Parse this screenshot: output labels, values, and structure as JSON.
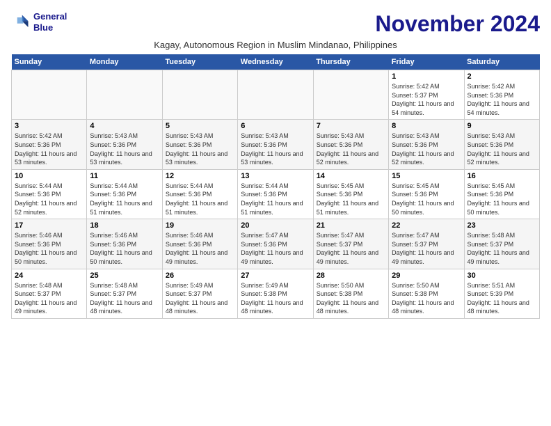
{
  "header": {
    "logo_line1": "General",
    "logo_line2": "Blue",
    "month": "November 2024",
    "subtitle": "Kagay, Autonomous Region in Muslim Mindanao, Philippines"
  },
  "weekdays": [
    "Sunday",
    "Monday",
    "Tuesday",
    "Wednesday",
    "Thursday",
    "Friday",
    "Saturday"
  ],
  "weeks": [
    [
      {
        "day": "",
        "empty": true
      },
      {
        "day": "",
        "empty": true
      },
      {
        "day": "",
        "empty": true
      },
      {
        "day": "",
        "empty": true
      },
      {
        "day": "",
        "empty": true
      },
      {
        "day": "1",
        "sunrise": "Sunrise: 5:42 AM",
        "sunset": "Sunset: 5:37 PM",
        "daylight": "Daylight: 11 hours and 54 minutes."
      },
      {
        "day": "2",
        "sunrise": "Sunrise: 5:42 AM",
        "sunset": "Sunset: 5:36 PM",
        "daylight": "Daylight: 11 hours and 54 minutes."
      }
    ],
    [
      {
        "day": "3",
        "sunrise": "Sunrise: 5:42 AM",
        "sunset": "Sunset: 5:36 PM",
        "daylight": "Daylight: 11 hours and 53 minutes."
      },
      {
        "day": "4",
        "sunrise": "Sunrise: 5:43 AM",
        "sunset": "Sunset: 5:36 PM",
        "daylight": "Daylight: 11 hours and 53 minutes."
      },
      {
        "day": "5",
        "sunrise": "Sunrise: 5:43 AM",
        "sunset": "Sunset: 5:36 PM",
        "daylight": "Daylight: 11 hours and 53 minutes."
      },
      {
        "day": "6",
        "sunrise": "Sunrise: 5:43 AM",
        "sunset": "Sunset: 5:36 PM",
        "daylight": "Daylight: 11 hours and 53 minutes."
      },
      {
        "day": "7",
        "sunrise": "Sunrise: 5:43 AM",
        "sunset": "Sunset: 5:36 PM",
        "daylight": "Daylight: 11 hours and 52 minutes."
      },
      {
        "day": "8",
        "sunrise": "Sunrise: 5:43 AM",
        "sunset": "Sunset: 5:36 PM",
        "daylight": "Daylight: 11 hours and 52 minutes."
      },
      {
        "day": "9",
        "sunrise": "Sunrise: 5:43 AM",
        "sunset": "Sunset: 5:36 PM",
        "daylight": "Daylight: 11 hours and 52 minutes."
      }
    ],
    [
      {
        "day": "10",
        "sunrise": "Sunrise: 5:44 AM",
        "sunset": "Sunset: 5:36 PM",
        "daylight": "Daylight: 11 hours and 52 minutes."
      },
      {
        "day": "11",
        "sunrise": "Sunrise: 5:44 AM",
        "sunset": "Sunset: 5:36 PM",
        "daylight": "Daylight: 11 hours and 51 minutes."
      },
      {
        "day": "12",
        "sunrise": "Sunrise: 5:44 AM",
        "sunset": "Sunset: 5:36 PM",
        "daylight": "Daylight: 11 hours and 51 minutes."
      },
      {
        "day": "13",
        "sunrise": "Sunrise: 5:44 AM",
        "sunset": "Sunset: 5:36 PM",
        "daylight": "Daylight: 11 hours and 51 minutes."
      },
      {
        "day": "14",
        "sunrise": "Sunrise: 5:45 AM",
        "sunset": "Sunset: 5:36 PM",
        "daylight": "Daylight: 11 hours and 51 minutes."
      },
      {
        "day": "15",
        "sunrise": "Sunrise: 5:45 AM",
        "sunset": "Sunset: 5:36 PM",
        "daylight": "Daylight: 11 hours and 50 minutes."
      },
      {
        "day": "16",
        "sunrise": "Sunrise: 5:45 AM",
        "sunset": "Sunset: 5:36 PM",
        "daylight": "Daylight: 11 hours and 50 minutes."
      }
    ],
    [
      {
        "day": "17",
        "sunrise": "Sunrise: 5:46 AM",
        "sunset": "Sunset: 5:36 PM",
        "daylight": "Daylight: 11 hours and 50 minutes."
      },
      {
        "day": "18",
        "sunrise": "Sunrise: 5:46 AM",
        "sunset": "Sunset: 5:36 PM",
        "daylight": "Daylight: 11 hours and 50 minutes."
      },
      {
        "day": "19",
        "sunrise": "Sunrise: 5:46 AM",
        "sunset": "Sunset: 5:36 PM",
        "daylight": "Daylight: 11 hours and 49 minutes."
      },
      {
        "day": "20",
        "sunrise": "Sunrise: 5:47 AM",
        "sunset": "Sunset: 5:36 PM",
        "daylight": "Daylight: 11 hours and 49 minutes."
      },
      {
        "day": "21",
        "sunrise": "Sunrise: 5:47 AM",
        "sunset": "Sunset: 5:37 PM",
        "daylight": "Daylight: 11 hours and 49 minutes."
      },
      {
        "day": "22",
        "sunrise": "Sunrise: 5:47 AM",
        "sunset": "Sunset: 5:37 PM",
        "daylight": "Daylight: 11 hours and 49 minutes."
      },
      {
        "day": "23",
        "sunrise": "Sunrise: 5:48 AM",
        "sunset": "Sunset: 5:37 PM",
        "daylight": "Daylight: 11 hours and 49 minutes."
      }
    ],
    [
      {
        "day": "24",
        "sunrise": "Sunrise: 5:48 AM",
        "sunset": "Sunset: 5:37 PM",
        "daylight": "Daylight: 11 hours and 49 minutes."
      },
      {
        "day": "25",
        "sunrise": "Sunrise: 5:48 AM",
        "sunset": "Sunset: 5:37 PM",
        "daylight": "Daylight: 11 hours and 48 minutes."
      },
      {
        "day": "26",
        "sunrise": "Sunrise: 5:49 AM",
        "sunset": "Sunset: 5:37 PM",
        "daylight": "Daylight: 11 hours and 48 minutes."
      },
      {
        "day": "27",
        "sunrise": "Sunrise: 5:49 AM",
        "sunset": "Sunset: 5:38 PM",
        "daylight": "Daylight: 11 hours and 48 minutes."
      },
      {
        "day": "28",
        "sunrise": "Sunrise: 5:50 AM",
        "sunset": "Sunset: 5:38 PM",
        "daylight": "Daylight: 11 hours and 48 minutes."
      },
      {
        "day": "29",
        "sunrise": "Sunrise: 5:50 AM",
        "sunset": "Sunset: 5:38 PM",
        "daylight": "Daylight: 11 hours and 48 minutes."
      },
      {
        "day": "30",
        "sunrise": "Sunrise: 5:51 AM",
        "sunset": "Sunset: 5:39 PM",
        "daylight": "Daylight: 11 hours and 48 minutes."
      }
    ]
  ]
}
